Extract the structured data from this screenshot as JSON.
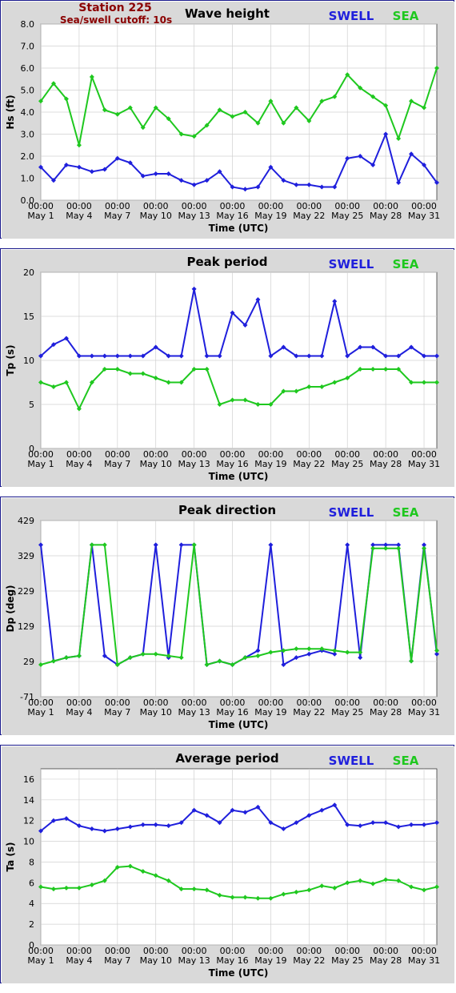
{
  "station_label": "Station 225",
  "cutoff_label": "Sea/swell cutoff: 10s",
  "colors": {
    "swell": "#1f1fdc",
    "sea": "#1fc81f",
    "station": "#8b0000",
    "frame_border": "#1a1a8c",
    "plot_bg": "#ffffff",
    "outer_bg": "#d9d9d9"
  },
  "x_tick_labels": [
    [
      "00:00",
      "May 1"
    ],
    [
      "00:00",
      "May 4"
    ],
    [
      "00:00",
      "May 7"
    ],
    [
      "00:00",
      "May 10"
    ],
    [
      "00:00",
      "May 13"
    ],
    [
      "00:00",
      "May 16"
    ],
    [
      "00:00",
      "May 19"
    ],
    [
      "00:00",
      "May 22"
    ],
    [
      "00:00",
      "May 25"
    ],
    [
      "00:00",
      "May 28"
    ],
    [
      "00:00",
      "May 31"
    ]
  ],
  "chart_data": [
    {
      "type": "line",
      "title": "Wave height",
      "xlabel": "Time (UTC)",
      "ylabel": "Hs (ft)",
      "ylim": [
        0,
        8
      ],
      "yticks": [
        "0.0",
        "1.0",
        "2.0",
        "3.0",
        "4.0",
        "5.0",
        "6.0",
        "7.0",
        "8.0"
      ],
      "grid": true,
      "legend": "top-right",
      "x": [
        "May 1",
        "May 2",
        "May 3",
        "May 4",
        "May 5",
        "May 6",
        "May 7",
        "May 8",
        "May 9",
        "May 10",
        "May 11",
        "May 12",
        "May 13",
        "May 14",
        "May 15",
        "May 16",
        "May 17",
        "May 18",
        "May 19",
        "May 20",
        "May 21",
        "May 22",
        "May 23",
        "May 24",
        "May 25",
        "May 26",
        "May 27",
        "May 28",
        "May 29",
        "May 30",
        "May 31",
        "Jun 1"
      ],
      "series": [
        {
          "name": "SWELL",
          "values": [
            1.5,
            0.9,
            1.6,
            1.5,
            1.3,
            1.4,
            1.9,
            1.7,
            1.1,
            1.2,
            1.2,
            0.9,
            0.7,
            0.9,
            1.3,
            0.6,
            0.5,
            0.6,
            1.5,
            0.9,
            0.7,
            0.7,
            0.6,
            0.6,
            1.9,
            2.0,
            1.6,
            3.0,
            0.8,
            2.1,
            1.6,
            0.8
          ]
        },
        {
          "name": "SEA",
          "values": [
            4.5,
            5.3,
            4.6,
            2.5,
            5.6,
            4.1,
            3.9,
            4.2,
            3.3,
            4.2,
            3.7,
            3.0,
            2.9,
            3.4,
            4.1,
            3.8,
            4.0,
            3.5,
            4.5,
            3.5,
            4.2,
            3.6,
            4.5,
            4.7,
            5.7,
            5.1,
            4.7,
            4.3,
            2.8,
            4.5,
            4.2,
            6.0
          ]
        }
      ]
    },
    {
      "type": "line",
      "title": "Peak period",
      "xlabel": "Time (UTC)",
      "ylabel": "Tp (s)",
      "ylim": [
        0,
        20
      ],
      "yticks": [
        "0",
        "5",
        "10",
        "15",
        "20"
      ],
      "grid": true,
      "legend": "top-right",
      "x": [
        "May 1",
        "May 2",
        "May 3",
        "May 4",
        "May 5",
        "May 6",
        "May 7",
        "May 8",
        "May 9",
        "May 10",
        "May 11",
        "May 12",
        "May 13",
        "May 14",
        "May 15",
        "May 16",
        "May 17",
        "May 18",
        "May 19",
        "May 20",
        "May 21",
        "May 22",
        "May 23",
        "May 24",
        "May 25",
        "May 26",
        "May 27",
        "May 28",
        "May 29",
        "May 30",
        "May 31",
        "Jun 1"
      ],
      "series": [
        {
          "name": "SWELL",
          "values": [
            10.5,
            11.8,
            12.5,
            10.5,
            10.5,
            10.5,
            10.5,
            10.5,
            10.5,
            11.5,
            10.5,
            10.5,
            18.1,
            10.5,
            10.5,
            15.4,
            14.0,
            16.9,
            10.5,
            11.5,
            10.5,
            10.5,
            10.5,
            16.7,
            10.5,
            11.5,
            11.5,
            10.5,
            10.5,
            11.5,
            10.5,
            10.5
          ]
        },
        {
          "name": "SEA",
          "values": [
            7.5,
            7.0,
            7.5,
            4.5,
            7.5,
            9.0,
            9.0,
            8.5,
            8.5,
            8.0,
            7.5,
            7.5,
            9.0,
            9.0,
            5.0,
            5.5,
            5.5,
            5.0,
            5.0,
            6.5,
            6.5,
            7.0,
            7.0,
            7.5,
            8.0,
            9.0,
            9.0,
            9.0,
            9.0,
            7.5,
            7.5,
            7.5
          ]
        }
      ]
    },
    {
      "type": "line",
      "title": "Peak direction",
      "xlabel": "Time (UTC)",
      "ylabel": "Dp (deg)",
      "ylim": [
        -71,
        429
      ],
      "yticks": [
        "-71",
        "29",
        "129",
        "229",
        "329",
        "429"
      ],
      "grid": true,
      "legend": "top-right",
      "x": [
        "May 1",
        "May 2",
        "May 3",
        "May 4",
        "May 5",
        "May 6",
        "May 7",
        "May 8",
        "May 9",
        "May 10",
        "May 11",
        "May 12",
        "May 13",
        "May 14",
        "May 15",
        "May 16",
        "May 17",
        "May 18",
        "May 19",
        "May 20",
        "May 21",
        "May 22",
        "May 23",
        "May 24",
        "May 25",
        "May 26",
        "May 27",
        "May 28",
        "May 29",
        "May 30",
        "May 31",
        "Jun 1"
      ],
      "series": [
        {
          "name": "SWELL",
          "values": [
            360,
            30,
            40,
            45,
            360,
            45,
            20,
            40,
            50,
            360,
            40,
            360,
            360,
            20,
            30,
            20,
            40,
            60,
            360,
            20,
            40,
            50,
            60,
            50,
            360,
            40,
            360,
            360,
            360,
            30,
            360,
            50
          ]
        },
        {
          "name": "SEA",
          "values": [
            20,
            30,
            40,
            45,
            360,
            360,
            20,
            40,
            50,
            50,
            45,
            40,
            360,
            20,
            30,
            20,
            40,
            45,
            55,
            60,
            65,
            65,
            65,
            60,
            55,
            55,
            350,
            350,
            350,
            30,
            350,
            60
          ]
        }
      ]
    },
    {
      "type": "line",
      "title": "Average period",
      "xlabel": "Time (UTC)",
      "ylabel": "Ta (s)",
      "ylim": [
        0,
        17
      ],
      "yticks": [
        "0",
        "2",
        "4",
        "6",
        "8",
        "10",
        "12",
        "14",
        "16"
      ],
      "grid": true,
      "legend": "top-right",
      "x": [
        "May 1",
        "May 2",
        "May 3",
        "May 4",
        "May 5",
        "May 6",
        "May 7",
        "May 8",
        "May 9",
        "May 10",
        "May 11",
        "May 12",
        "May 13",
        "May 14",
        "May 15",
        "May 16",
        "May 17",
        "May 18",
        "May 19",
        "May 20",
        "May 21",
        "May 22",
        "May 23",
        "May 24",
        "May 25",
        "May 26",
        "May 27",
        "May 28",
        "May 29",
        "May 30",
        "May 31",
        "Jun 1"
      ],
      "series": [
        {
          "name": "SWELL",
          "values": [
            11.0,
            12.0,
            12.2,
            11.5,
            11.2,
            11.0,
            11.2,
            11.4,
            11.6,
            11.6,
            11.5,
            11.8,
            13.0,
            12.5,
            11.8,
            13.0,
            12.8,
            13.3,
            11.8,
            11.2,
            11.8,
            12.5,
            13.0,
            13.5,
            11.6,
            11.5,
            11.8,
            11.8,
            11.4,
            11.6,
            11.6,
            11.8
          ]
        },
        {
          "name": "SEA",
          "values": [
            5.6,
            5.4,
            5.5,
            5.5,
            5.8,
            6.2,
            7.5,
            7.6,
            7.1,
            6.7,
            6.2,
            5.4,
            5.4,
            5.3,
            4.8,
            4.6,
            4.6,
            4.5,
            4.5,
            4.9,
            5.1,
            5.3,
            5.7,
            5.5,
            6.0,
            6.2,
            5.9,
            6.3,
            6.2,
            5.6,
            5.3,
            5.6
          ]
        }
      ]
    }
  ]
}
